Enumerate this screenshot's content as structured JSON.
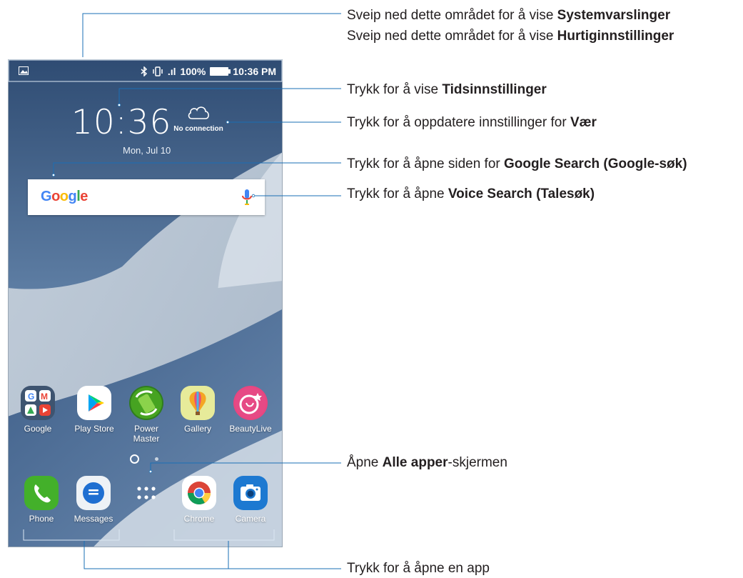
{
  "status_bar": {
    "signal": ".ıl",
    "battery": "100%",
    "time": "10:36 PM"
  },
  "home": {
    "clock": "10:36",
    "date": "Mon, Jul 10",
    "weather": "No connection",
    "search_logo": "Google"
  },
  "apps_row": [
    {
      "label": "Google",
      "icon": "google-folder-icon"
    },
    {
      "label": "Play Store",
      "icon": "play-store-icon"
    },
    {
      "label": "Power\nMaster",
      "icon": "power-master-icon"
    },
    {
      "label": "Gallery",
      "icon": "gallery-icon"
    },
    {
      "label": "BeautyLive",
      "icon": "beautylive-icon"
    }
  ],
  "dock": [
    {
      "label": "Phone",
      "icon": "phone-icon"
    },
    {
      "label": "Messages",
      "icon": "messages-icon"
    },
    {
      "label": "",
      "icon": "all-apps-icon"
    },
    {
      "label": "Chrome",
      "icon": "chrome-icon"
    },
    {
      "label": "Camera",
      "icon": "camera-icon"
    }
  ],
  "annotations": {
    "notifications": {
      "prefix": "Sveip ned dette området for å vise ",
      "bold": "Systemvarslinger",
      "suffix": ""
    },
    "quick_settings": {
      "prefix": "Sveip ned dette området for å vise ",
      "bold": "Hurtiginnstillinger",
      "suffix": ""
    },
    "time_settings": {
      "prefix": "Trykk for å vise ",
      "bold": "Tidsinnstillinger",
      "suffix": ""
    },
    "weather": {
      "prefix": "Trykk for å oppdatere innstillinger for ",
      "bold": "Vær",
      "suffix": ""
    },
    "google_search": {
      "prefix": "Trykk for å åpne siden for ",
      "bold": "Google Search (Google-søk)",
      "suffix": ""
    },
    "voice_search": {
      "prefix": "Trykk for å åpne ",
      "bold": "Voice Search (Talesøk)",
      "suffix": ""
    },
    "all_apps": {
      "prefix": "Åpne ",
      "bold": "Alle apper",
      "suffix": "-skjermen"
    },
    "open_app": {
      "prefix": "Trykk for å åpne en app",
      "bold": "",
      "suffix": ""
    }
  }
}
